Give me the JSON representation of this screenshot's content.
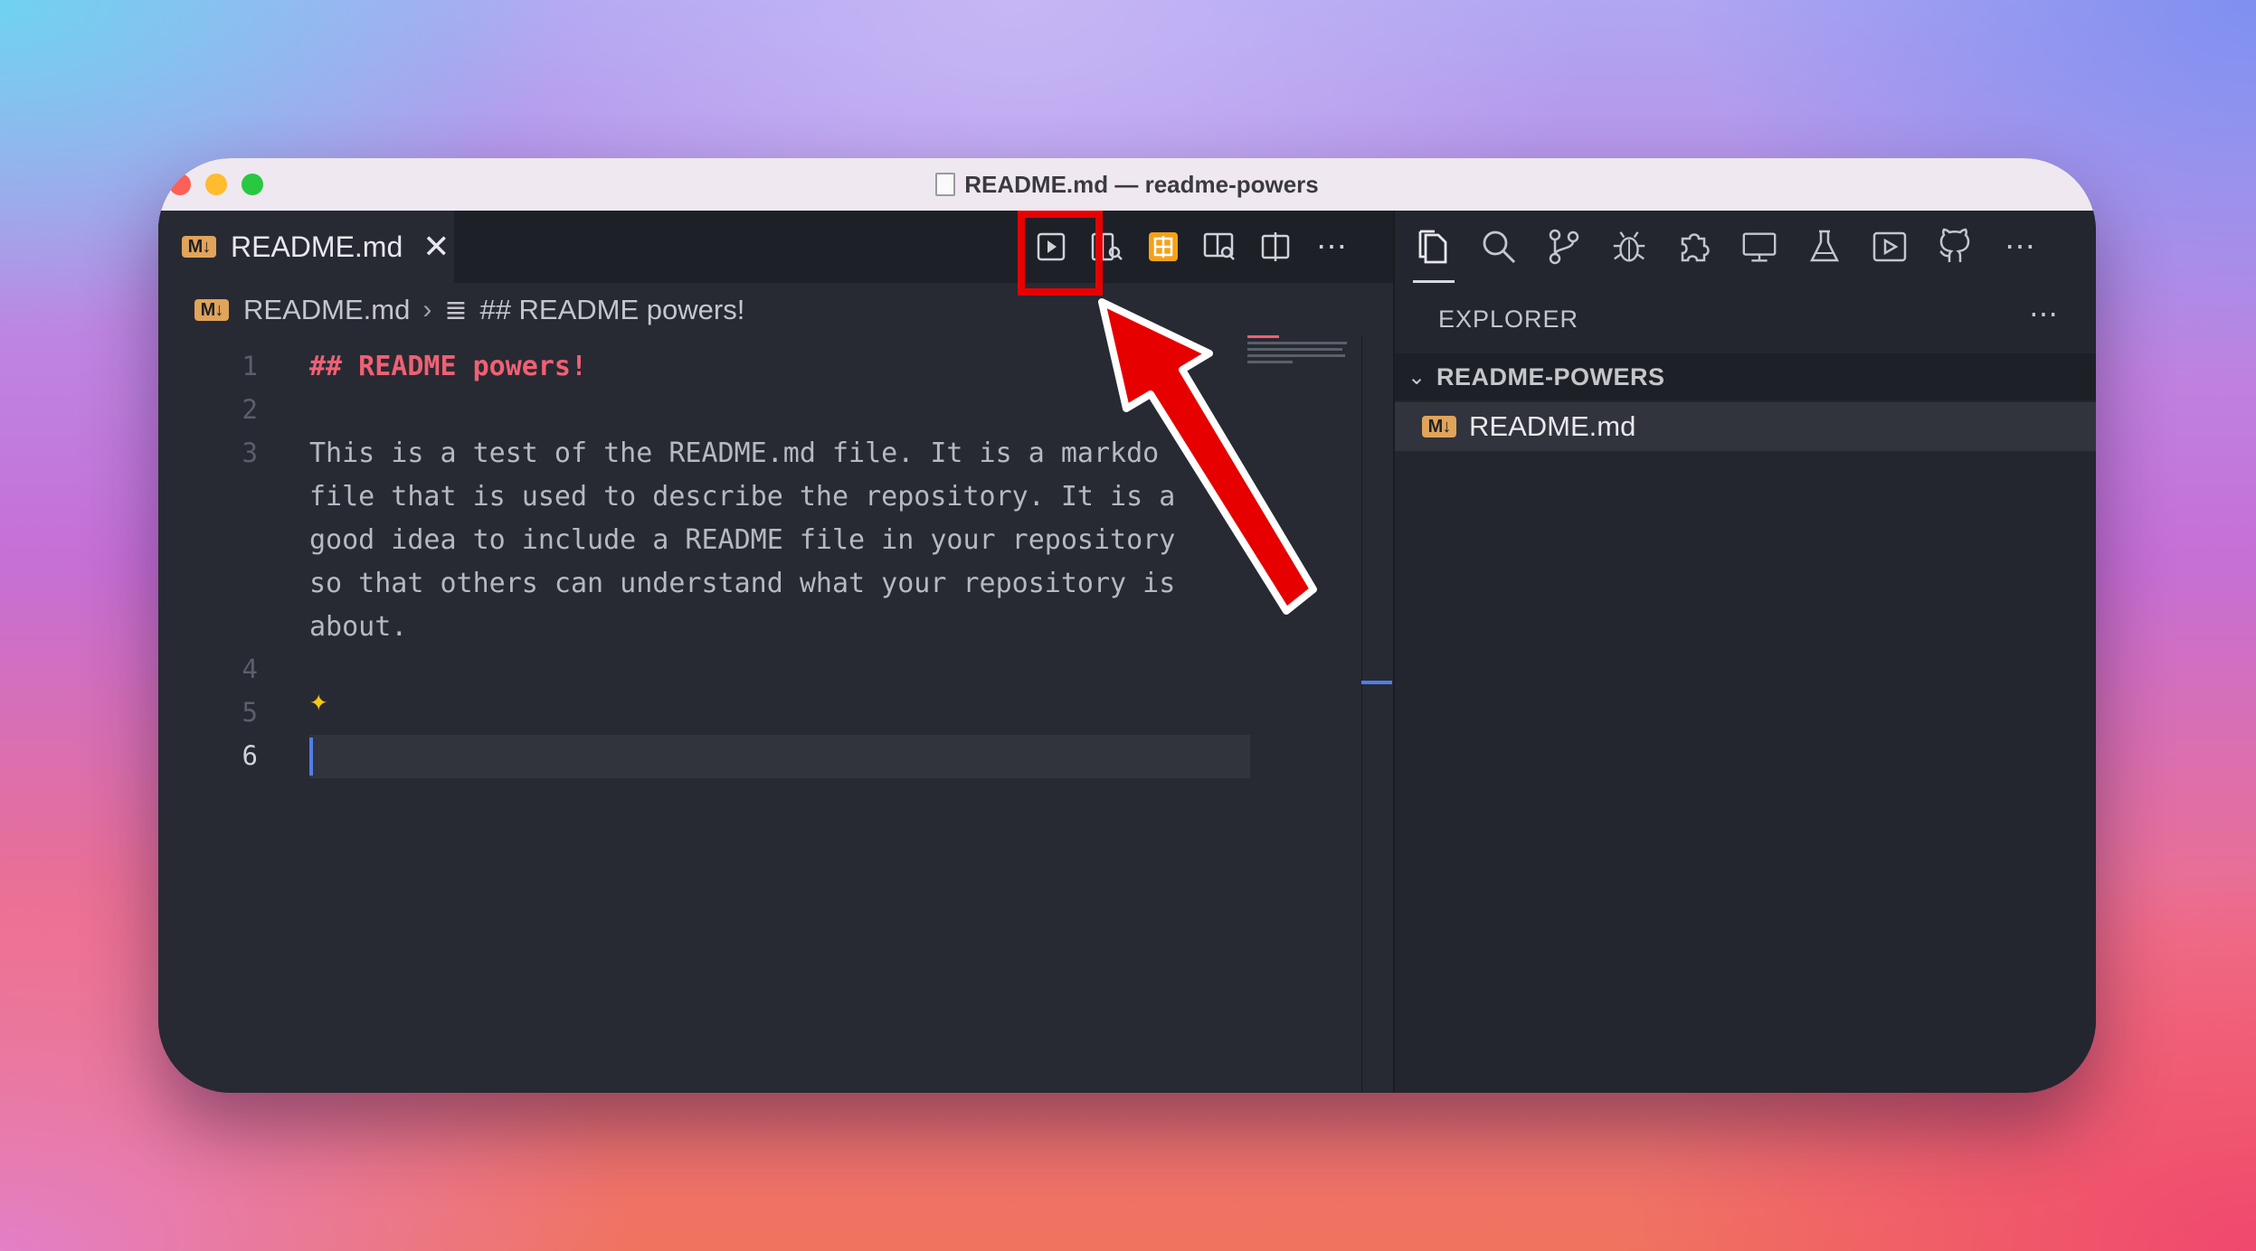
{
  "window": {
    "title": "README.md — readme-powers"
  },
  "tab": {
    "badge": "M↓",
    "label": "README.md",
    "close": "✕"
  },
  "breadcrumb": {
    "badge": "M↓",
    "file": "README.md",
    "separator": "›",
    "symbol_icon": "≣",
    "section": "## README powers!"
  },
  "editor": {
    "line_numbers": [
      "1",
      "2",
      "3",
      "4",
      "5",
      "6"
    ],
    "lines": [
      "## README powers!",
      "This is a test of the README.md file. It is a markdo",
      "file that is used to describe the repository. It is a",
      "good idea to include a README file in your repository",
      "so that others can understand what your repository is",
      "about."
    ],
    "sparkle": "✦"
  },
  "toolbar": {
    "icons": [
      "open-preview-icon",
      "preview-to-side-icon",
      "table-icon",
      "open-changes-icon",
      "split-editor-icon",
      "more-actions-icon"
    ],
    "more": "⋯"
  },
  "activity_bar": {
    "icons": [
      "files-icon",
      "search-icon",
      "source-control-icon",
      "debug-icon",
      "extensions-icon",
      "remote-explorer-icon",
      "testing-icon",
      "run-icon",
      "github-icon",
      "more-icon"
    ],
    "more": "⋯"
  },
  "explorer": {
    "title": "EXPLORER",
    "more": "⋯",
    "folder": "README-POWERS",
    "folder_chevron": "⌄",
    "file_badge": "M↓",
    "file": "README.md"
  },
  "annotation": {
    "color": "#e60000"
  }
}
